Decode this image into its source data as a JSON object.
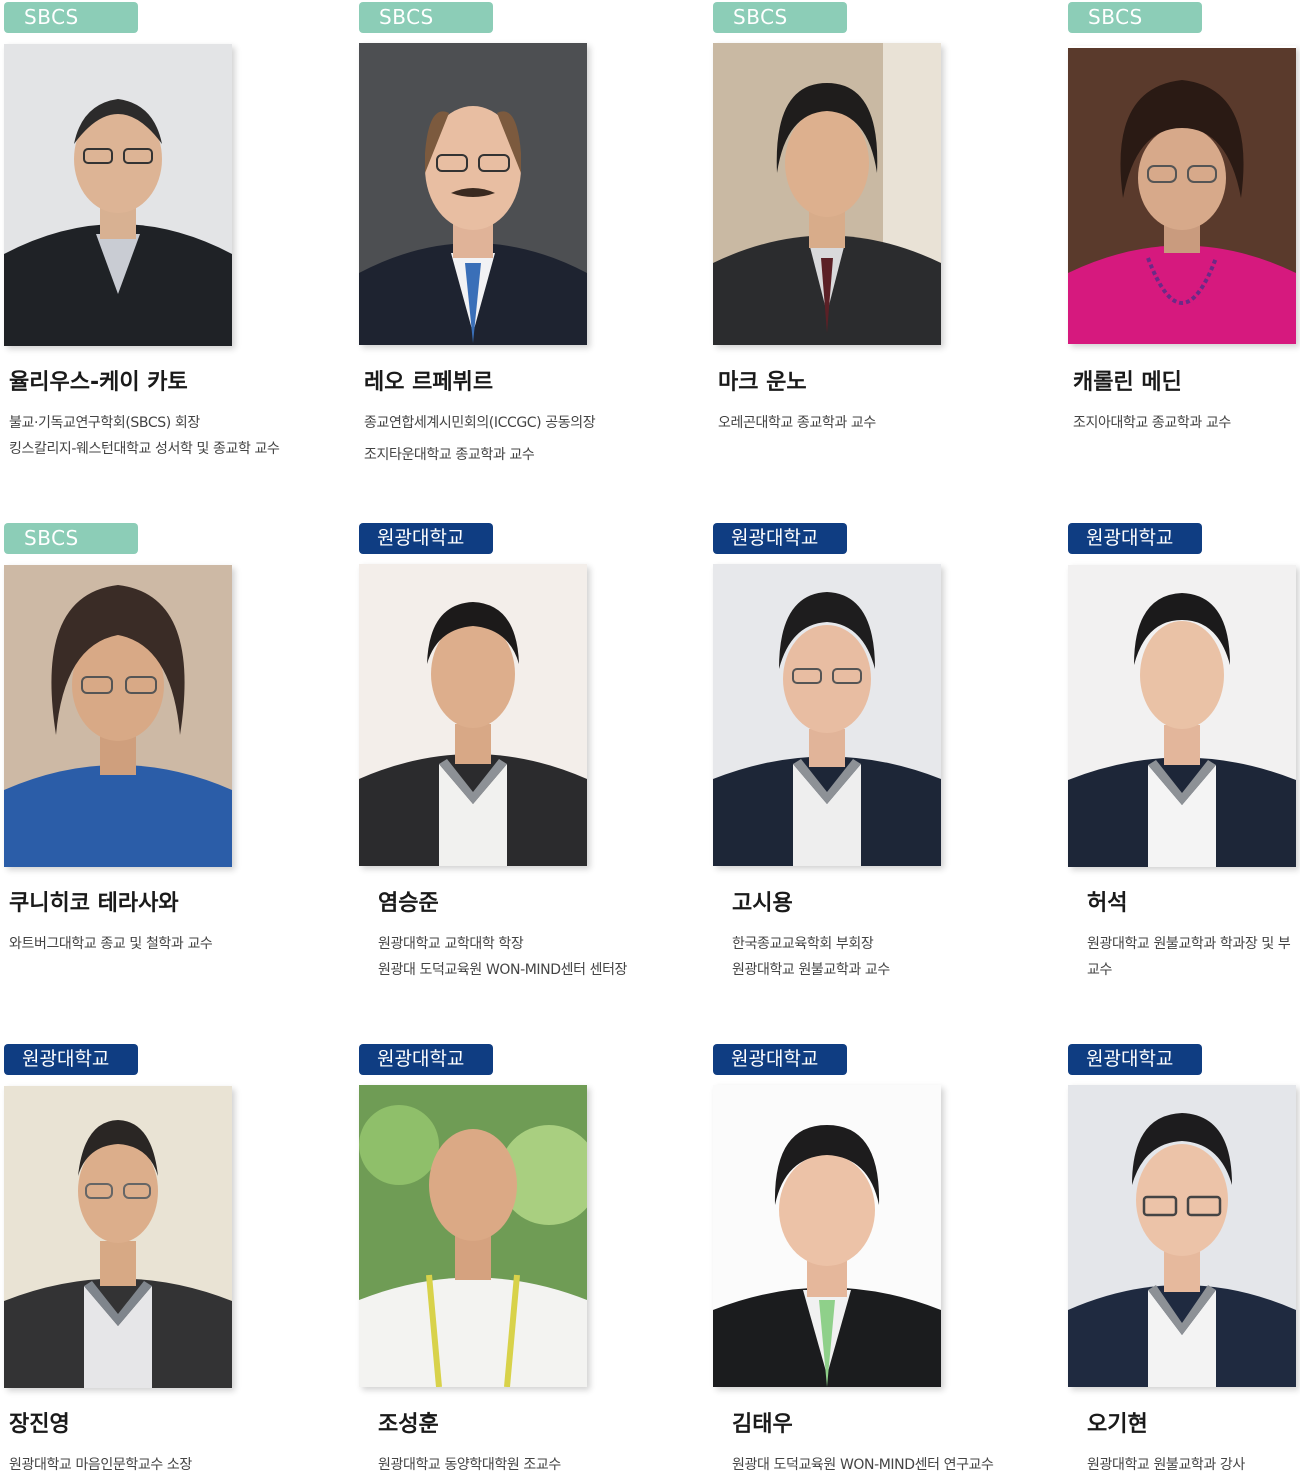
{
  "colors": {
    "sbcs_badge": "#8ccdb7",
    "wku_badge": "#0f3d82",
    "name_text": "#1a1a1a",
    "affiliation_text": "#444444"
  },
  "badges": {
    "sbcs": "SBCS",
    "wku": "원광대학교"
  },
  "people": [
    {
      "badge": "SBCS",
      "name": "율리우스-케이 카토",
      "lines": [
        "불교·기독교연구학회(SBCS) 회장",
        "킹스칼리지-웨스턴대학교 성서학 및 종교학 교수"
      ]
    },
    {
      "badge": "SBCS",
      "name": "레오 르페뷔르",
      "lines": [
        "종교연합세계시민회의(ICCGC) 공동의장",
        "조지타운대학교 종교학과 교수"
      ]
    },
    {
      "badge": "SBCS",
      "name": "마크 운노",
      "lines": [
        "오레곤대학교 종교학과 교수"
      ]
    },
    {
      "badge": "SBCS",
      "name": "캐롤린 메딘",
      "lines": [
        "조지아대학교 종교학과 교수"
      ]
    },
    {
      "badge": "SBCS",
      "name": "쿠니히코 테라사와",
      "lines": [
        "와트버그대학교 종교 및 철학과 교수"
      ]
    },
    {
      "badge": "원광대학교",
      "name": "염승준",
      "lines": [
        "원광대학교 교학대학 학장",
        "원광대 도덕교육원 WON-MIND센터 센터장"
      ]
    },
    {
      "badge": "원광대학교",
      "name": "고시용",
      "lines": [
        "한국종교교육학회 부회장",
        "원광대학교 원불교학과 교수"
      ]
    },
    {
      "badge": "원광대학교",
      "name": "허석",
      "lines": [
        "원광대학교 원불교학과 학과장 및 부교수"
      ]
    },
    {
      "badge": "원광대학교",
      "name": "장진영",
      "lines": [
        "원광대학교 마음인문학교수 소장"
      ]
    },
    {
      "badge": "원광대학교",
      "name": "조성훈",
      "lines": [
        "원광대학교 동양학대학원 조교수"
      ]
    },
    {
      "badge": "원광대학교",
      "name": "김태우",
      "lines": [
        "원광대 도덕교육원 WON-MIND센터 연구교수"
      ]
    },
    {
      "badge": "원광대학교",
      "name": "오기현",
      "lines": [
        "원광대학교 원불교학과 강사"
      ]
    }
  ]
}
